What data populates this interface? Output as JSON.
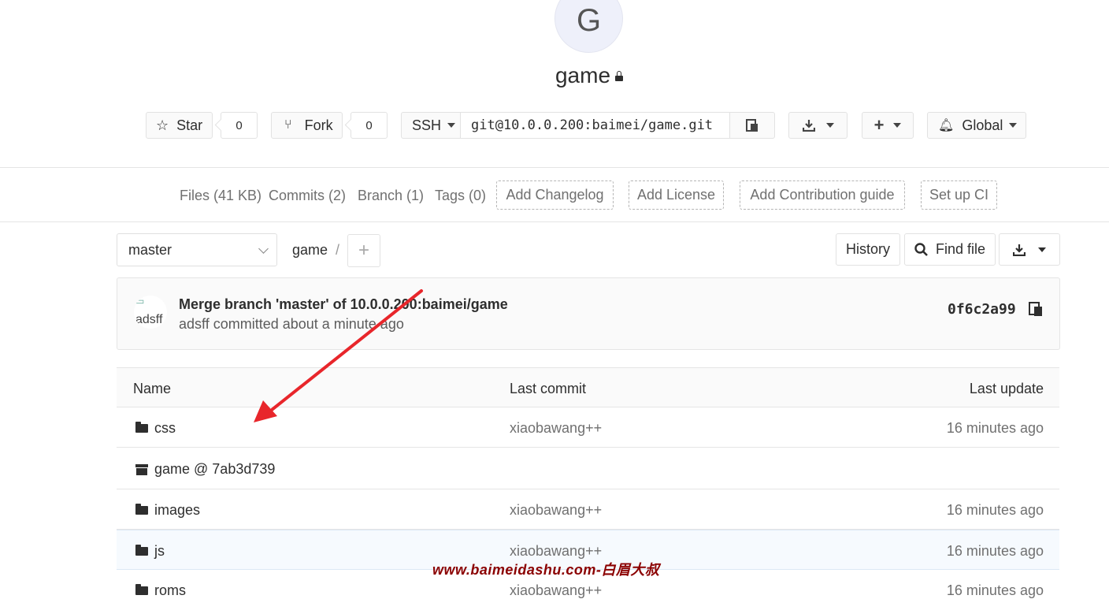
{
  "project": {
    "avatar_letter": "G",
    "name": "game"
  },
  "actions": {
    "star_label": "Star",
    "star_count": "0",
    "fork_label": "Fork",
    "fork_count": "0",
    "protocol": "SSH",
    "clone_url": "git@10.0.0.200:baimei/game.git",
    "notification_level": "Global"
  },
  "stats": {
    "files": "Files (41 KB)",
    "commits": "Commits (2)",
    "branch": "Branch (1)",
    "tags": "Tags (0)",
    "add_changelog": "Add Changelog",
    "add_license": "Add License",
    "add_contribution": "Add Contribution guide",
    "setup_ci": "Set up CI"
  },
  "tree": {
    "branch": "master",
    "breadcrumb": "game",
    "breadcrumb_sep": "/",
    "history_label": "History",
    "find_file_label": "Find file"
  },
  "last_commit": {
    "author_avatar_alt": "adsff",
    "message": "Merge branch 'master' of 10.0.0.200:baimei/game",
    "meta": "adsff committed about a minute ago",
    "sha": "0f6c2a99"
  },
  "table": {
    "headers": {
      "name": "Name",
      "last_commit": "Last commit",
      "last_update": "Last update"
    },
    "rows": [
      {
        "name": "css",
        "type": "folder",
        "last_commit": "xiaobawang++",
        "last_update": "16 minutes ago"
      },
      {
        "name": "game @ 7ab3d739",
        "type": "submodule",
        "last_commit": "",
        "last_update": ""
      },
      {
        "name": "images",
        "type": "folder",
        "last_commit": "xiaobawang++",
        "last_update": "16 minutes ago"
      },
      {
        "name": "js",
        "type": "folder",
        "last_commit": "xiaobawang++",
        "last_update": "16 minutes ago"
      },
      {
        "name": "roms",
        "type": "folder",
        "last_commit": "xiaobawang++",
        "last_update": "16 minutes ago"
      }
    ]
  },
  "watermark": "www.baimeidashu.com-白眉大叔",
  "colors": {
    "arrow": "#e8262b",
    "watermark": "#8b0000",
    "hover_row": "#f6fafe"
  }
}
